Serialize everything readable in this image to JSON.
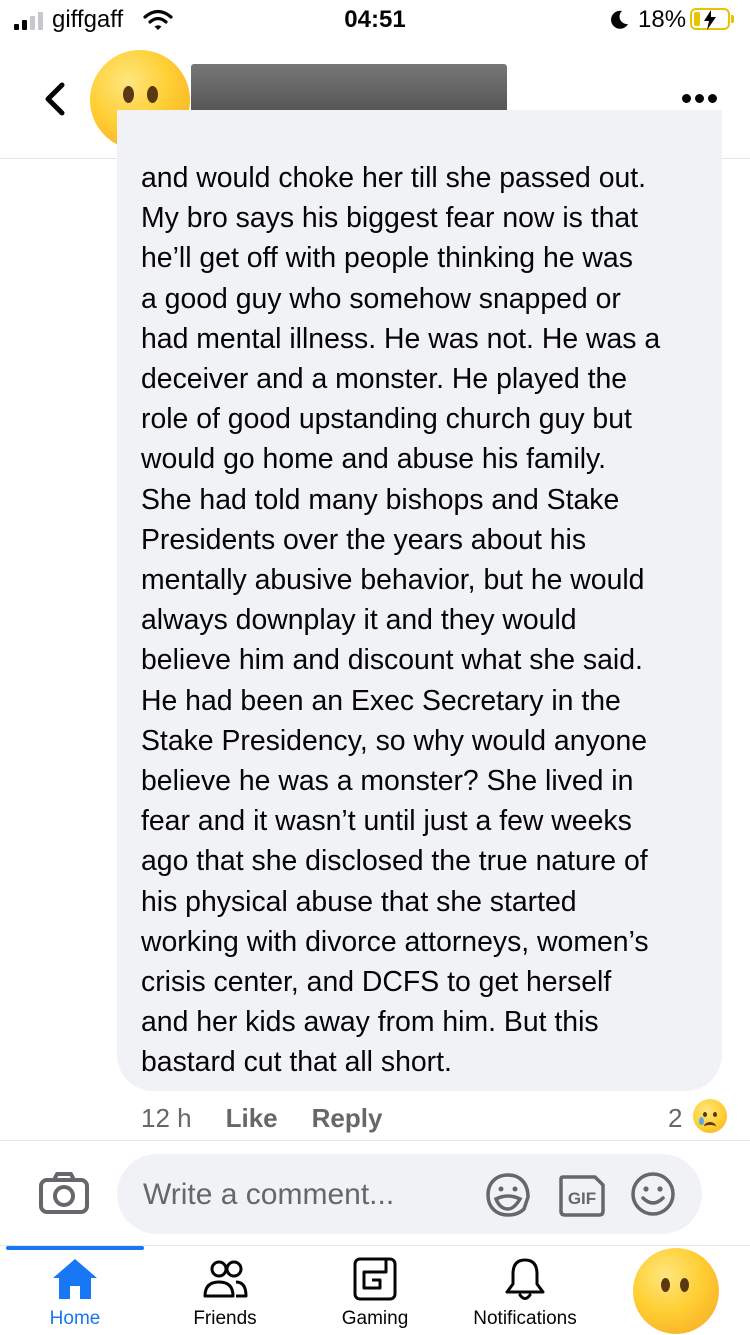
{
  "status_bar": {
    "carrier": "giffgaff",
    "time": "04:51",
    "battery_percent": "18%",
    "signal_bars": 2,
    "charging": true,
    "focus_mode": "do-not-disturb",
    "icons": [
      "signal-icon",
      "wifi-icon",
      "moon-icon",
      "battery-icon"
    ]
  },
  "header": {
    "back_icon": "chevron-left-icon",
    "avatar": "slightly-frowning-face-emoji",
    "name_redacted": true,
    "more_icon": "more-horizontal-icon"
  },
  "comment": {
    "lines": [
      "and would choke her till she passed out.",
      "My bro says his biggest fear now is that",
      "he’ll get off with people thinking he was",
      "a good guy who somehow snapped or",
      "had mental illness. He was not. He was a",
      "deceiver and a monster. He played the",
      "role of good upstanding church guy but",
      "would go home and abuse his family.",
      "She had told many bishops and Stake",
      "Presidents over the years about his",
      "mentally abusive behavior, but he would",
      "always downplay it and they would",
      "believe him and discount what she said.",
      "He had been an Exec Secretary in the",
      "Stake Presidency, so why would anyone",
      "believe he was a monster? She lived in",
      "fear and it wasn’t until just a few weeks",
      "ago that she disclosed the true nature of",
      "his physical abuse that she started",
      "working with divorce attorneys, women’s",
      "crisis center, and DCFS to get herself",
      "and her kids away from him. But this",
      "bastard cut that all short."
    ],
    "time": "12 h",
    "like_label": "Like",
    "reply_label": "Reply",
    "reaction_count": "2",
    "reaction_icon": "sad-crying-face-icon"
  },
  "composer": {
    "placeholder": "Write a comment...",
    "value": "",
    "icons": [
      "camera-icon",
      "sticker-icon",
      "gif-icon",
      "emoji-icon"
    ],
    "gif_label": "GIF"
  },
  "tab_bar": {
    "tabs": [
      {
        "label": "Home",
        "icon": "home-icon",
        "active": true
      },
      {
        "label": "Friends",
        "icon": "friends-icon",
        "active": false
      },
      {
        "label": "Gaming",
        "icon": "gaming-icon",
        "active": false
      },
      {
        "label": "Notifications",
        "icon": "bell-icon",
        "active": false
      }
    ],
    "profile_icon": "profile-avatar-emoji"
  },
  "colors": {
    "accent": "#1877f2",
    "bubble": "#f0f2f5",
    "secondary_text": "#65676b",
    "battery": "#e8c300"
  }
}
